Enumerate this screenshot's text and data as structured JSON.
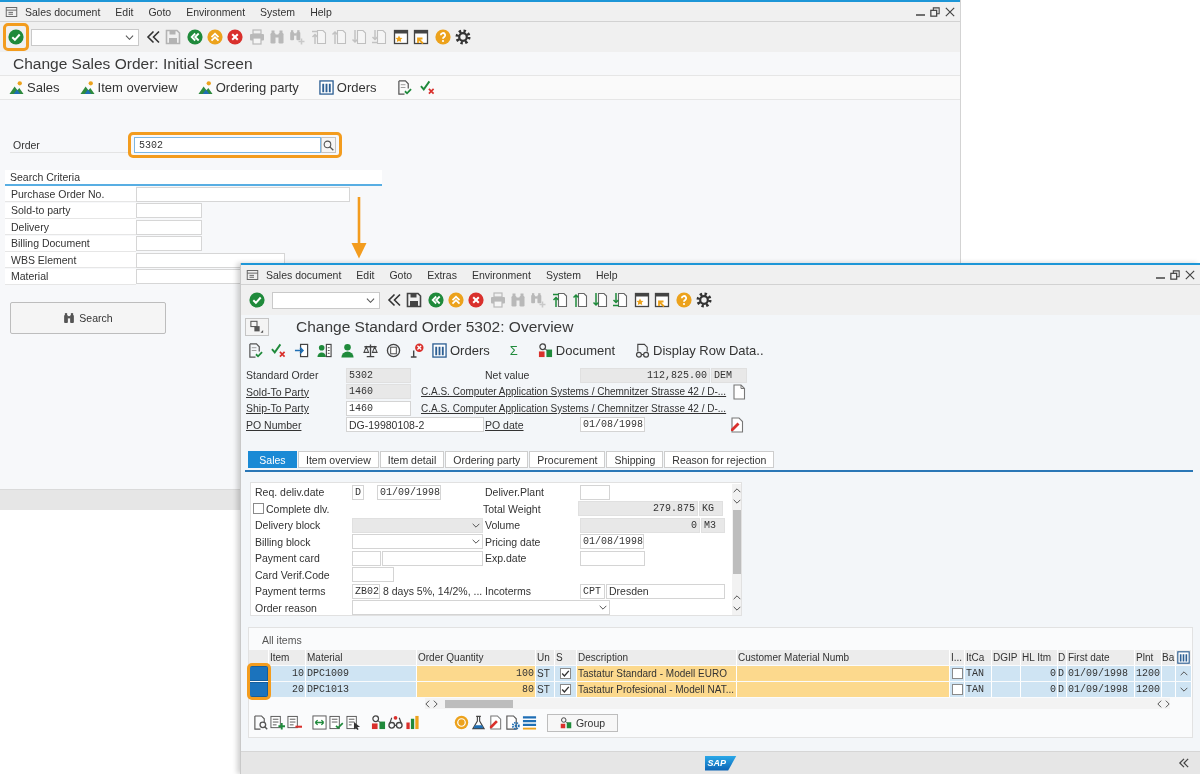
{
  "initial_screen": {
    "menu": [
      "Sales document",
      "Edit",
      "Goto",
      "Environment",
      "System",
      "Help"
    ],
    "toolbar": {
      "enter_highlighted": true,
      "groups": [
        [
          {
            "kind": "collapse",
            "disabled": false
          },
          {
            "kind": "save",
            "disabled": true
          }
        ],
        [
          {
            "kind": "back",
            "disabled": false
          },
          {
            "kind": "exit",
            "disabled": false
          },
          {
            "kind": "cancel",
            "disabled": false
          }
        ],
        [
          {
            "kind": "print",
            "disabled": true
          },
          {
            "kind": "find",
            "disabled": true
          },
          {
            "kind": "find-next",
            "disabled": true
          }
        ],
        [
          {
            "kind": "first-page",
            "disabled": true
          },
          {
            "kind": "prev-page",
            "disabled": true
          },
          {
            "kind": "next-page",
            "disabled": true
          },
          {
            "kind": "last-page",
            "disabled": true
          }
        ],
        [
          {
            "kind": "new-session",
            "disabled": false
          },
          {
            "kind": "shortcut",
            "disabled": false
          }
        ],
        [
          {
            "kind": "help",
            "disabled": false
          },
          {
            "kind": "settings",
            "disabled": false
          }
        ]
      ]
    },
    "title": "Change Sales Order: Initial Screen",
    "app_toolbar": [
      {
        "kind": "mountain",
        "label": "Sales"
      },
      {
        "kind": "mountain",
        "label": "Item overview"
      },
      {
        "kind": "mountain",
        "label": "Ordering party"
      },
      {
        "kind": "columns",
        "label": "Orders"
      },
      {
        "kind": "doc-check"
      },
      {
        "kind": "check-cross"
      }
    ],
    "order": {
      "label": "Order",
      "value": "5302",
      "highlighted": true
    },
    "search_criteria": {
      "title": "Search Criteria",
      "fields": [
        "Purchase Order No.",
        "Sold-to party",
        "Delivery",
        "Billing Document",
        "WBS Element",
        "Material"
      ],
      "button": "Search"
    }
  },
  "overview_screen": {
    "menu": [
      "Sales document",
      "Edit",
      "Goto",
      "Extras",
      "Environment",
      "System",
      "Help"
    ],
    "toolbar": {
      "enter_highlighted": false,
      "groups": [
        [
          {
            "kind": "collapse",
            "disabled": false
          },
          {
            "kind": "save",
            "disabled": false
          }
        ],
        [
          {
            "kind": "back",
            "disabled": false
          },
          {
            "kind": "exit",
            "disabled": false
          },
          {
            "kind": "cancel",
            "disabled": false
          }
        ],
        [
          {
            "kind": "print",
            "disabled": true
          },
          {
            "kind": "find",
            "disabled": true
          },
          {
            "kind": "find-next",
            "disabled": true
          }
        ],
        [
          {
            "kind": "first-page",
            "disabled": false
          },
          {
            "kind": "prev-page",
            "disabled": false
          },
          {
            "kind": "next-page",
            "disabled": false
          },
          {
            "kind": "last-page",
            "disabled": false
          }
        ],
        [
          {
            "kind": "new-session",
            "disabled": false
          },
          {
            "kind": "shortcut",
            "disabled": false
          }
        ],
        [
          {
            "kind": "help",
            "disabled": false
          },
          {
            "kind": "settings",
            "disabled": false
          }
        ]
      ]
    },
    "title": "Change Standard Order 5302: Overview",
    "app_toolbar": [
      {
        "kind": "doc-check"
      },
      {
        "kind": "check-cross"
      },
      {
        "kind": "import"
      },
      {
        "kind": "person-card"
      },
      {
        "kind": "person"
      },
      {
        "kind": "scales"
      },
      {
        "kind": "doc-cycle"
      },
      {
        "kind": "pin-cross"
      },
      {
        "kind": "columns",
        "label": "Orders"
      },
      {
        "kind": "text",
        "label": "Σ"
      },
      {
        "kind": "blocks",
        "label": "Document"
      },
      {
        "kind": "doc-glasses",
        "label": "Display Row Data.."
      }
    ],
    "header": {
      "order": {
        "label": "Standard Order",
        "link": false,
        "value": "5302",
        "readonly": true
      },
      "net_value": {
        "label": "Net value",
        "link": false,
        "value": "112,825.00",
        "currency": "DEM",
        "readonly": true
      },
      "sold_to": {
        "label": "Sold-To Party",
        "link": true,
        "value": "1460",
        "readonly": true,
        "name": "C.A.S. Computer Application Systems / Chemnitzer Strasse 42 / D-..."
      },
      "ship_to": {
        "label": "Ship-To Party",
        "link": true,
        "value": "1460",
        "readonly": false,
        "name": "C.A.S. Computer Application Systems / Chemnitzer Strasse 42 / D-..."
      },
      "po_number": {
        "label": "PO Number",
        "link": true,
        "value": "DG-19980108-2",
        "readonly": false
      },
      "po_date": {
        "label": "PO date",
        "link": true,
        "value": "01/08/1998",
        "readonly": false
      }
    },
    "tabs": [
      {
        "label": "Sales",
        "selected": true
      },
      {
        "label": "Item overview",
        "selected": false
      },
      {
        "label": "Item detail",
        "selected": false
      },
      {
        "label": "Ordering party",
        "selected": false
      },
      {
        "label": "Procurement",
        "selected": false
      },
      {
        "label": "Shipping",
        "selected": false
      },
      {
        "label": "Reason for rejection",
        "selected": false
      }
    ],
    "sales_tab": {
      "rows": [
        {
          "left": {
            "kind": "date",
            "label": "Req. deliv.date",
            "format": "D",
            "value": "01/09/1998",
            "readonly": false
          },
          "right": {
            "kind": "input",
            "label": "Deliver.Plant",
            "readonly": false
          }
        },
        {
          "left": {
            "kind": "checkbox",
            "label": "Complete dlv.",
            "checked": false
          },
          "right": {
            "kind": "quantity",
            "label": "Total Weight",
            "value": "279.875",
            "unit": "KG",
            "readonly": true
          }
        },
        {
          "left": {
            "kind": "dropdown",
            "label": "Delivery block",
            "readonly": true
          },
          "right": {
            "kind": "quantity",
            "label": "Volume",
            "value": "0",
            "unit": "M3",
            "readonly": true
          }
        },
        {
          "left": {
            "kind": "dropdown",
            "label": "Billing block",
            "readonly": false
          },
          "right": {
            "kind": "date",
            "label": "Pricing date",
            "value": "01/08/1998",
            "readonly": false
          }
        },
        {
          "left": {
            "kind": "card",
            "label": "Payment card",
            "readonly": false
          },
          "right": {
            "kind": "input",
            "label": "Exp.date",
            "readonly": false
          }
        },
        {
          "left": {
            "kind": "input",
            "label": "Card Verif.Code",
            "readonly": false
          }
        },
        {
          "left": {
            "kind": "codetext",
            "label": "Payment terms",
            "code": "ZB02",
            "text": "8 days 5%, 14/2%, ...",
            "readonly": false
          },
          "right": {
            "kind": "codeinput",
            "label": "Incoterms",
            "code": "CPT",
            "text": "Dresden",
            "readonly": false
          }
        },
        {
          "left": {
            "kind": "dropdown",
            "label": "Order reason",
            "readonly": false
          }
        }
      ]
    },
    "items": {
      "title": "All items",
      "highlight_selectors": true,
      "columns": [
        {
          "label": "Item",
          "editable": false
        },
        {
          "label": "Material",
          "editable": false
        },
        {
          "label": "Order Quantity",
          "editable": true
        },
        {
          "label": "Un",
          "editable": false
        },
        {
          "label": "S",
          "editable": false
        },
        {
          "label": "Description",
          "editable": true
        },
        {
          "label": "Customer Material Numb",
          "editable": true
        },
        {
          "label": "I...",
          "editable": false
        },
        {
          "label": "ItCa",
          "editable": false
        },
        {
          "label": "DGIP",
          "editable": false
        },
        {
          "label": "HL Itm",
          "editable": false
        },
        {
          "label": "D",
          "editable": false
        },
        {
          "label": "First date",
          "editable": false
        },
        {
          "label": "Plnt",
          "editable": false
        },
        {
          "label": "Ba",
          "editable": false
        }
      ],
      "rows": [
        {
          "selected": true,
          "item": "10",
          "material": "DPC1009",
          "quantity": "100",
          "unit": "ST",
          "s_checked": true,
          "description": "Tastatur Standard - Modell EURO",
          "i_checked": false,
          "category": "TAN",
          "hl_item": "0",
          "d": "D",
          "first_date": "01/09/1998",
          "plant": "1200"
        },
        {
          "selected": true,
          "item": "20",
          "material": "DPC1013",
          "quantity": "80",
          "unit": "ST",
          "s_checked": true,
          "description": "Tastatur Profesional - Modell NAT...",
          "i_checked": false,
          "category": "TAN",
          "hl_item": "0",
          "d": "D",
          "first_date": "01/09/1998",
          "plant": "1200"
        }
      ]
    },
    "table_toolbar": {
      "groups": [
        [
          {
            "kind": "doc-search"
          },
          {
            "kind": "list-plus"
          },
          {
            "kind": "list-minus"
          }
        ],
        [
          {
            "kind": "box-arrows"
          },
          {
            "kind": "list-check"
          },
          {
            "kind": "list-cursor"
          }
        ],
        [
          {
            "kind": "blocks"
          },
          {
            "kind": "glasses"
          },
          {
            "kind": "bar-chart"
          }
        ],
        [
          {
            "kind": "coin"
          },
          {
            "kind": "flask"
          },
          {
            "kind": "doc-pen"
          },
          {
            "kind": "gear-doc"
          },
          {
            "kind": "stack"
          }
        ]
      ],
      "group_button": "Group"
    },
    "status_bar": {
      "logo": "SAP"
    }
  }
}
